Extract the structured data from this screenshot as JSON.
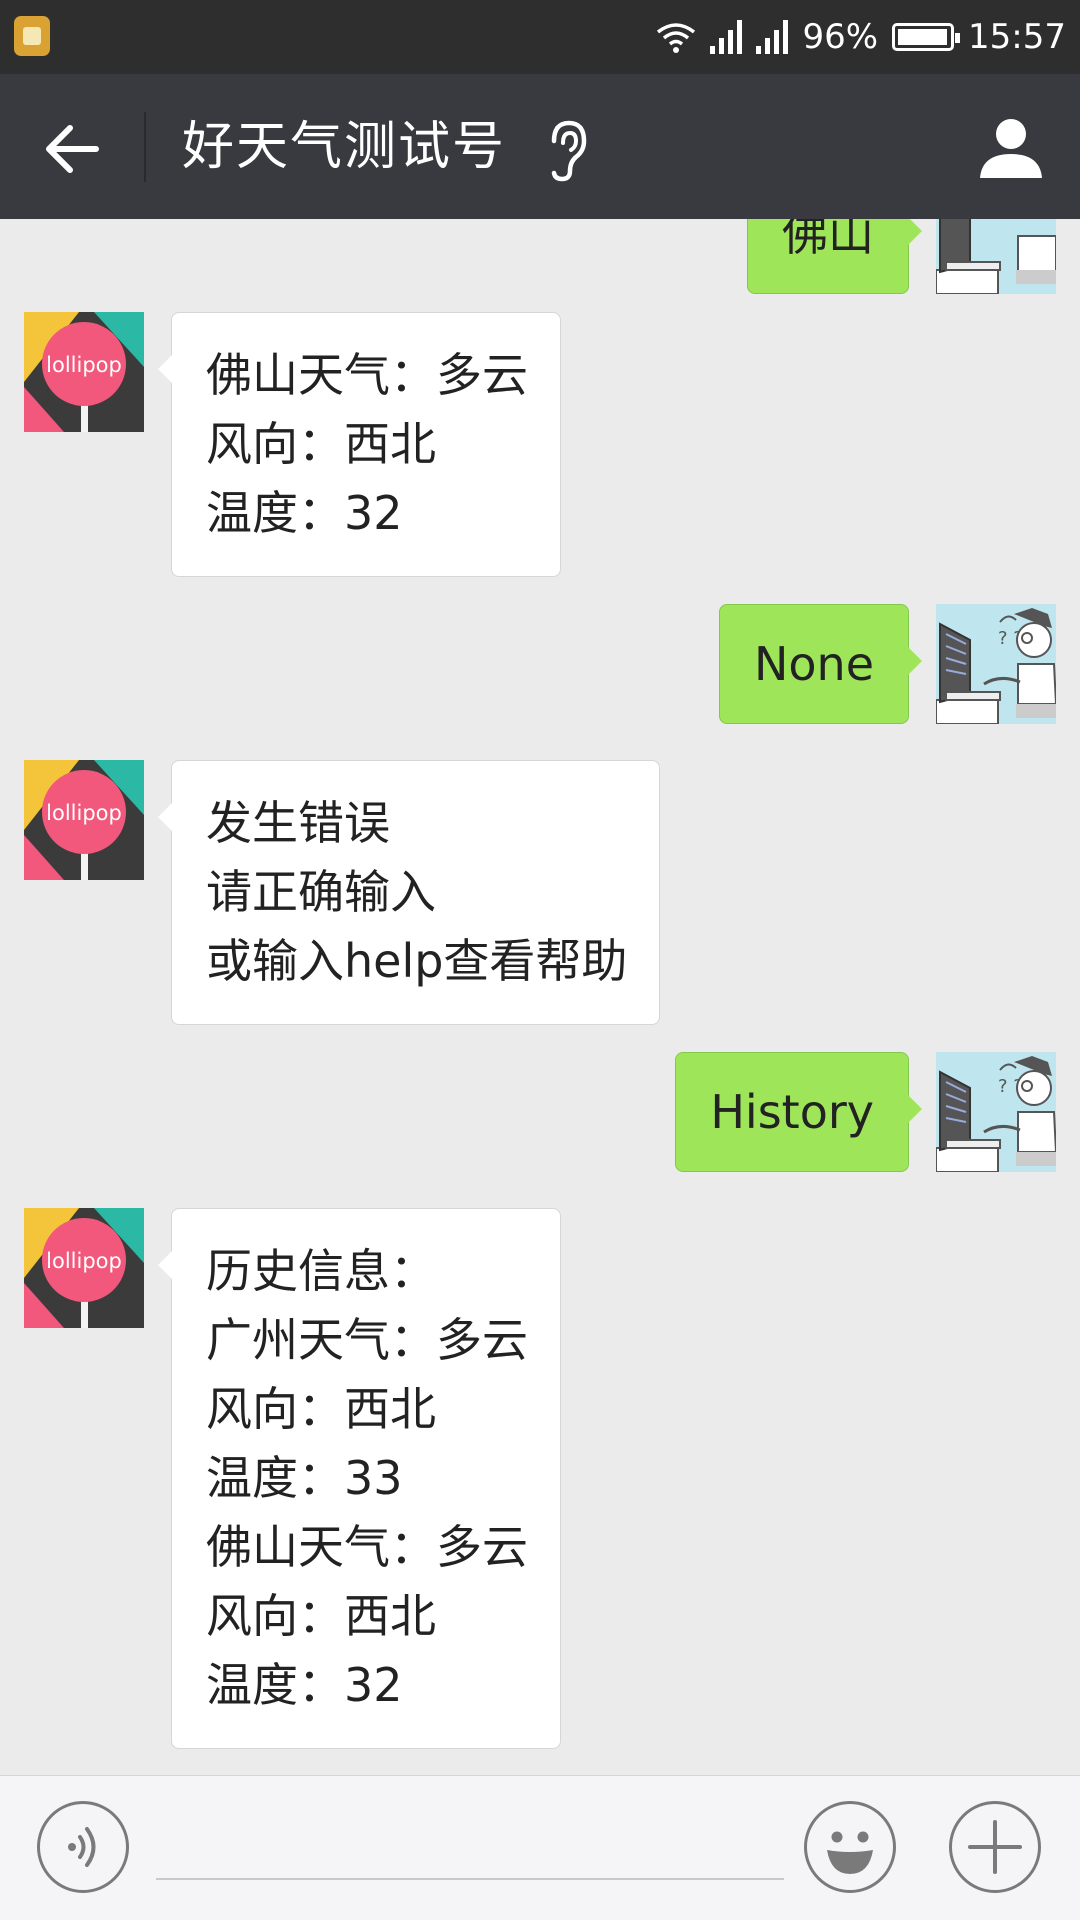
{
  "status_bar": {
    "battery_percent": "96%",
    "time": "15:57",
    "icons": [
      "app-notification-icon",
      "wifi-icon",
      "signal-icon",
      "signal-icon",
      "battery-icon"
    ]
  },
  "header": {
    "title": "好天气测试号",
    "icons": [
      "back-arrow-icon",
      "ear-icon",
      "profile-icon"
    ]
  },
  "messages": [
    {
      "from": "me",
      "text": [
        "佛山"
      ]
    },
    {
      "from": "bot",
      "text": [
        "佛山天气：多云",
        "风向：西北",
        "温度：32"
      ]
    },
    {
      "from": "me",
      "text": [
        "None"
      ]
    },
    {
      "from": "bot",
      "text": [
        "发生错误",
        "请正确输入",
        "或输入help查看帮助"
      ]
    },
    {
      "from": "me",
      "text": [
        "History"
      ]
    },
    {
      "from": "bot",
      "text": [
        "历史信息：",
        "广州天气：多云",
        "风向：西北",
        "温度：33",
        "佛山天气：多云",
        "风向：西北",
        "温度：32"
      ]
    }
  ],
  "avatars": {
    "bot_label": "lollipop",
    "bot_colors": {
      "pink": "#f1587b",
      "teal": "#2bb9a6",
      "dark": "#3b3b3b",
      "yellow": "#f4c43a"
    },
    "user_colors": {
      "sky": "#bfe6ee"
    }
  },
  "input_bar": {
    "placeholder": "",
    "icons": [
      "voice-icon",
      "emoji-icon",
      "plus-icon"
    ]
  },
  "colors": {
    "header_bg": "#393a3f",
    "chat_bg": "#ebebeb",
    "bubble_out": "#9fe559",
    "bubble_in": "#ffffff"
  }
}
